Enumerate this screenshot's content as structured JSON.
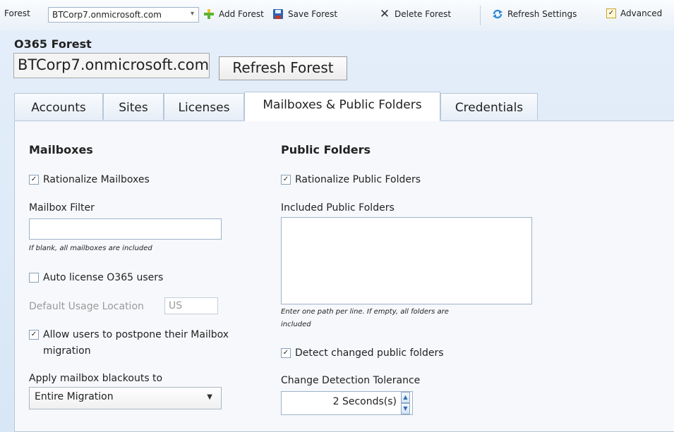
{
  "toolbar": {
    "forest_label": "Forest",
    "forest_value": "BTCorp7.onmicrosoft.com",
    "add_forest": "Add Forest",
    "save_forest": "Save Forest",
    "delete_forest": "Delete Forest",
    "refresh_settings": "Refresh Settings",
    "advanced": "Advanced",
    "advanced_checked": true
  },
  "header": {
    "title": "O365 Forest",
    "forest_name": "BTCorp7.onmicrosoft.com",
    "refresh_button": "Refresh Forest"
  },
  "tabs": [
    {
      "label": "Accounts",
      "active": false
    },
    {
      "label": "Sites",
      "active": false
    },
    {
      "label": "Licenses",
      "active": false
    },
    {
      "label": "Mailboxes & Public Folders",
      "active": true
    },
    {
      "label": "Credentials",
      "active": false
    }
  ],
  "mailboxes": {
    "heading": "Mailboxes",
    "rationalize_label": "Rationalize Mailboxes",
    "rationalize_checked": true,
    "filter_label": "Mailbox Filter",
    "filter_value": "",
    "filter_hint": "If blank, all mailboxes are included",
    "auto_license_label": "Auto license O365 users",
    "auto_license_checked": false,
    "usage_location_label": "Default Usage Location",
    "usage_location_value": "US",
    "postpone_label_line1": "Allow users to postpone their Mailbox",
    "postpone_label_line2": "migration",
    "postpone_checked": true,
    "blackouts_label": "Apply mailbox blackouts to",
    "blackouts_value": "Entire Migration"
  },
  "public_folders": {
    "heading": "Public Folders",
    "rationalize_label": "Rationalize Public Folders",
    "rationalize_checked": true,
    "included_label": "Included Public Folders",
    "included_value": "",
    "included_hint_line1": "Enter one path per line. If empty, all folders are",
    "included_hint_line2": "included",
    "detect_label": "Detect changed public folders",
    "detect_checked": true,
    "tolerance_label": "Change Detection Tolerance",
    "tolerance_value": "2 Seconds(s)"
  },
  "colors": {
    "accent": "#2f6cb0",
    "add_icon": "#5cb531",
    "save_icon": "#2e62b4"
  }
}
